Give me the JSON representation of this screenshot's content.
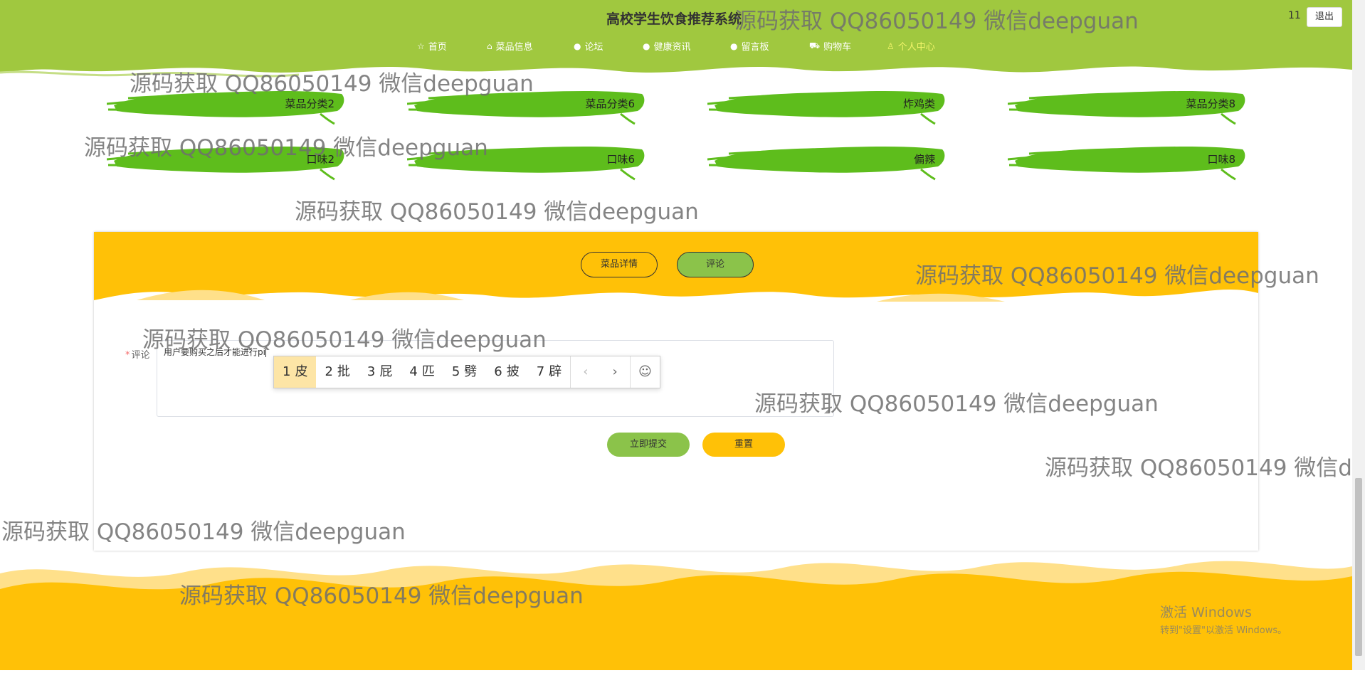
{
  "header": {
    "title": "高校学生饮食推荐系统",
    "user": "11",
    "logout_label": "退出",
    "nav": [
      {
        "label": "首页",
        "icon": "star-icon"
      },
      {
        "label": "菜品信息",
        "icon": "shopping-bag-icon"
      },
      {
        "label": "论坛",
        "icon": "info-circle-icon"
      },
      {
        "label": "健康资讯",
        "icon": "info-circle-icon"
      },
      {
        "label": "留言板",
        "icon": "info-circle-icon"
      },
      {
        "label": "购物车",
        "icon": "cart-icon"
      },
      {
        "label": "个人中心",
        "icon": "user-icon"
      }
    ]
  },
  "categories": {
    "row1": [
      "菜品分类2",
      "菜品分类6",
      "炸鸡类",
      "菜品分类8"
    ],
    "row2": [
      "口味2",
      "口味6",
      "偏辣",
      "口味8"
    ]
  },
  "detail": {
    "tabs": {
      "detail": "菜品详情",
      "comment": "评论"
    },
    "form": {
      "label": "评论",
      "value": "用户要购买之后才能进行pi",
      "submit": "立即提交",
      "reset": "重置"
    }
  },
  "ime": {
    "candidates": [
      {
        "num": "1",
        "char": "皮"
      },
      {
        "num": "2",
        "char": "批"
      },
      {
        "num": "3",
        "char": "屁"
      },
      {
        "num": "4",
        "char": "匹"
      },
      {
        "num": "5",
        "char": "劈"
      },
      {
        "num": "6",
        "char": "披"
      },
      {
        "num": "7",
        "char": "辟"
      }
    ],
    "prev": "‹",
    "next": "›",
    "emoji": "☺"
  },
  "watermark": "源码获取 QQ86050149 微信deepguan",
  "windows": {
    "line1": "激活 Windows",
    "line2": "转到\"设置\"以激活 Windows。"
  },
  "colors": {
    "green": "#a0c83f",
    "yellow": "#ffc107",
    "brush": "#5ebd1c"
  }
}
